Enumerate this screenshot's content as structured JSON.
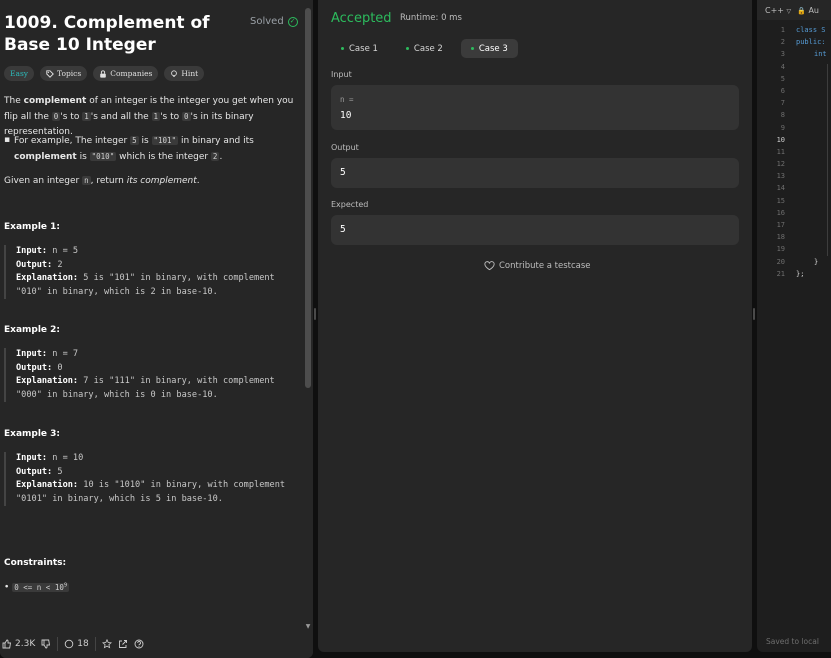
{
  "problem": {
    "title": "1009. Complement of Base 10 Integer",
    "solved_label": "Solved",
    "tags": [
      "Easy",
      "Topics",
      "Companies",
      "Hint"
    ],
    "description": {
      "p1_a": "The ",
      "p1_b": "complement",
      "p1_c": " of an integer is the integer you get when you flip all the ",
      "p1_code1": "0",
      "p1_d": "'s to ",
      "p1_code2": "1",
      "p1_e": "'s and all the ",
      "p1_code3": "1",
      "p1_f": "'s to ",
      "p1_code4": "0",
      "p1_g": "'s in its binary representation.",
      "b_a": "For example, The integer ",
      "b_code1": "5",
      "b_b": " is ",
      "b_code2": "\"101\"",
      "b_c": " in binary and its ",
      "b_d": "complement",
      "b_e": " is ",
      "b_code3": "\"010\"",
      "b_f": " which is the integer ",
      "b_code4": "2",
      "b_g": ".",
      "given_a": "Given an integer ",
      "given_code": "n",
      "given_b": ", return ",
      "given_c": "its complement",
      "given_d": "."
    },
    "examples": [
      {
        "heading": "Example 1:",
        "input": "n = 5",
        "output": "2",
        "explanation": "5 is \"101\" in binary, with complement \"010\" in binary, which is 2 in base-10."
      },
      {
        "heading": "Example 2:",
        "input": "n = 7",
        "output": "0",
        "explanation": "7 is \"111\" in binary, with complement \"000\" in binary, which is 0 in base-10."
      },
      {
        "heading": "Example 3:",
        "input": "n = 10",
        "output": "5",
        "explanation": "10 is \"1010\" in binary, with complement \"0101\" in binary, which is 5 in base-10."
      }
    ],
    "labels": {
      "input": "Input:",
      "output": "Output:",
      "explanation": "Explanation:"
    },
    "constraints_heading": "Constraints:",
    "constraint_base": "0 <= n < 10",
    "constraint_exp": "9"
  },
  "footer": {
    "likes": "2.3K",
    "comments": "18"
  },
  "result": {
    "status": "Accepted",
    "runtime": "Runtime: 0 ms",
    "cases": [
      "Case 1",
      "Case 2",
      "Case 3"
    ],
    "input_label": "Input",
    "input_var": "n =",
    "input_value": "10",
    "output_label": "Output",
    "output_value": "5",
    "expected_label": "Expected",
    "expected_value": "5",
    "contribute": "Contribute a testcase"
  },
  "editor": {
    "language": "C++",
    "mode": "Au",
    "line_numbers": [
      "1",
      "2",
      "3",
      "4",
      "5",
      "6",
      "7",
      "8",
      "9",
      "10",
      "11",
      "12",
      "13",
      "14",
      "15",
      "16",
      "17",
      "18",
      "19",
      "20",
      "21"
    ],
    "code_line1": "class S",
    "code_line2": "public:",
    "code_line3": "int",
    "code_line20": "}",
    "code_line21": "};",
    "saved": "Saved to local"
  },
  "colors": {
    "accent_green": "#2cbb5d",
    "easy_teal": "#2cbbbb",
    "panel": "#262626"
  }
}
